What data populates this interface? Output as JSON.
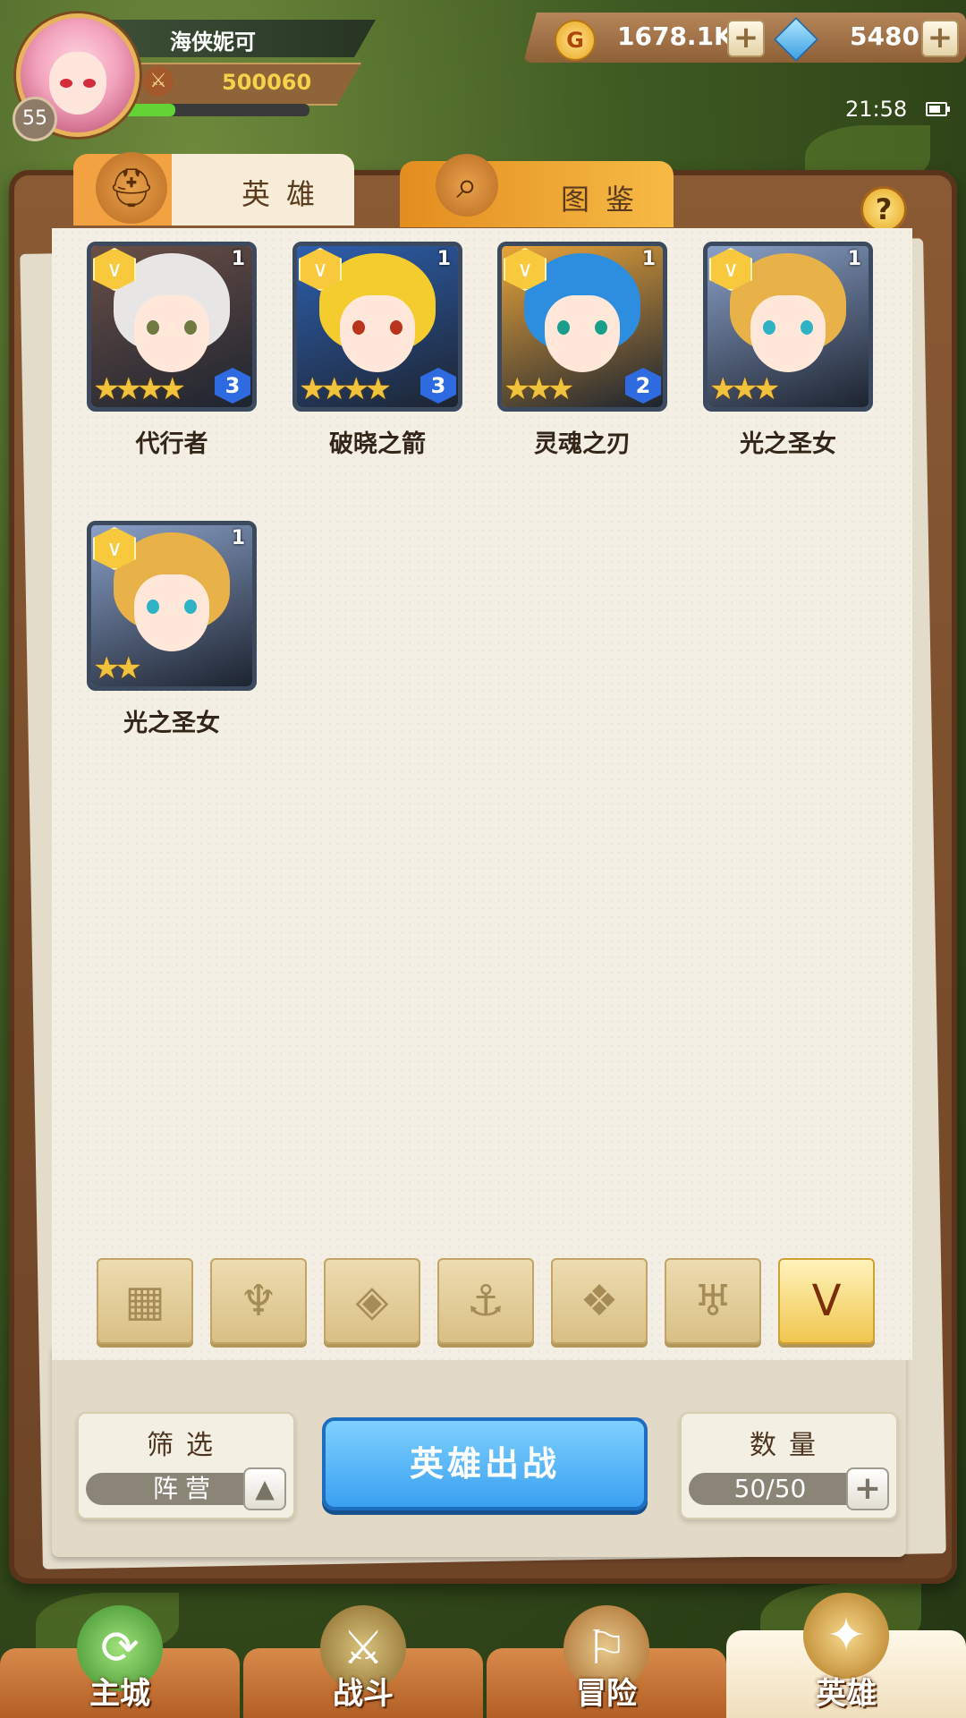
{
  "player": {
    "name": "海侠妮可",
    "level": "55",
    "power": "500060",
    "xp_fraction": 0.3
  },
  "resources": {
    "gold": "1678.1K",
    "gems": "5480",
    "plus": "+"
  },
  "status": {
    "time": "21:58"
  },
  "tabs": [
    {
      "label": "英雄"
    },
    {
      "label": "图鉴"
    }
  ],
  "help": "?",
  "heroes": [
    {
      "name": "代行者",
      "level": "1",
      "stars": "★★★★",
      "rank": "3",
      "hair": "#e8e6e4",
      "skin_eye": "#6f7a40",
      "bg": "#6b4f46"
    },
    {
      "name": "破晓之箭",
      "level": "1",
      "stars": "★★★★",
      "rank": "3",
      "hair": "#f5cc2e",
      "skin_eye": "#b8341c",
      "bg": "#2d5fae"
    },
    {
      "name": "灵魂之刃",
      "level": "1",
      "stars": "★★★",
      "rank": "2",
      "hair": "#2d8ee0",
      "skin_eye": "#1a9e8c",
      "bg": "#e8a43a"
    },
    {
      "name": "光之圣女",
      "level": "1",
      "stars": "★★★",
      "rank": "",
      "hair": "#e8b248",
      "skin_eye": "#2fb2c4",
      "bg": "#8aa0c8"
    },
    {
      "name": "光之圣女",
      "level": "1",
      "stars": "★★",
      "rank": "",
      "hair": "#e8b248",
      "skin_eye": "#2fb2c4",
      "bg": "#8aa0c8"
    }
  ],
  "filters": [
    {
      "icon": "grid-icon",
      "glyph": "▦"
    },
    {
      "icon": "flame-icon",
      "glyph": "♆"
    },
    {
      "icon": "diamond-icon",
      "glyph": "◈"
    },
    {
      "icon": "anchor-icon",
      "glyph": "⚓"
    },
    {
      "icon": "beast-icon",
      "glyph": "❖"
    },
    {
      "icon": "horns-icon",
      "glyph": "♅"
    },
    {
      "icon": "chevron-icon",
      "glyph": "V"
    }
  ],
  "controls": {
    "filter_title": "筛选",
    "filter_value": "阵营",
    "deploy": "英雄出战",
    "count_title": "数量",
    "count_value": "50/50"
  },
  "nav": [
    {
      "label": "主城",
      "icon": "castle-icon"
    },
    {
      "label": "战斗",
      "icon": "swords-icon"
    },
    {
      "label": "冒险",
      "icon": "map-icon"
    },
    {
      "label": "英雄",
      "icon": "helmet-icon"
    }
  ]
}
